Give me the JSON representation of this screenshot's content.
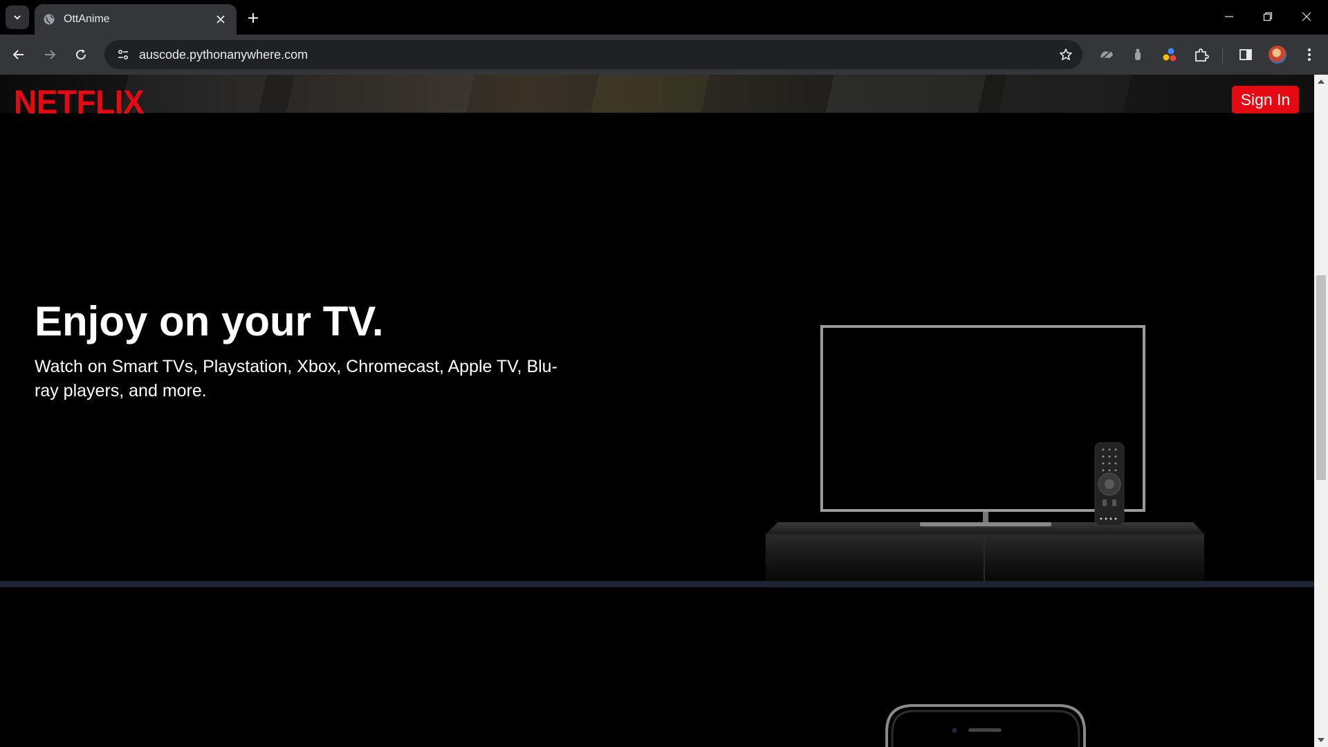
{
  "browser": {
    "tab_title": "OttAnime",
    "url": "auscode.pythonanywhere.com",
    "icons": [
      "tab-list-icon",
      "globe-icon",
      "close-icon",
      "plus-icon",
      "minimize-icon",
      "restore-icon",
      "window-close-icon",
      "back-icon",
      "forward-icon",
      "reload-icon",
      "site-info-icon",
      "star-icon",
      "extension-icons",
      "puzzle-icon",
      "sidepanel-icon",
      "avatar",
      "more-icon"
    ]
  },
  "header": {
    "logo": "NETFLIX",
    "signin_label": "Sign In",
    "accent_color": "#e50914"
  },
  "section_tv": {
    "title": "Enjoy on your TV.",
    "subtitle": "Watch on Smart TVs, Playstation, Xbox, Chromecast, Apple TV, Blu-ray players, and more."
  }
}
